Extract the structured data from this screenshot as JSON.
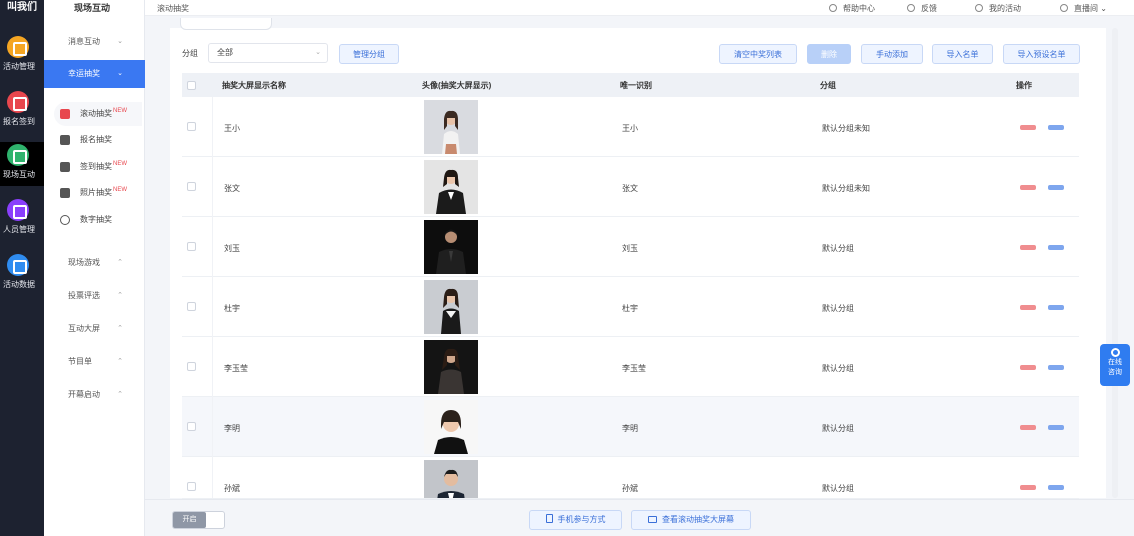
{
  "rail": {
    "logo": "叫我们",
    "items": [
      {
        "label": "活动管理",
        "icon": "calendar-icon",
        "color": "#f5a623"
      },
      {
        "label": "报名签到",
        "icon": "checkin-icon",
        "color": "#e8474e"
      },
      {
        "label": "现场互动",
        "icon": "interaction-icon",
        "color": "#2fb36d"
      },
      {
        "label": "人员管理",
        "icon": "person-icon",
        "color": "#8a3ffc"
      },
      {
        "label": "活动数据",
        "icon": "data-icon",
        "color": "#2f8cf0"
      }
    ]
  },
  "menu": {
    "title": "现场互动",
    "groups_top": [
      {
        "label": "消息互动"
      },
      {
        "label": "幸运抽奖"
      }
    ],
    "sub_items": [
      {
        "label": "滚动抽奖",
        "hot": "NEW",
        "icon": "lottery-icon",
        "color": "#e8474e"
      },
      {
        "label": "报名抽奖",
        "hot": "",
        "icon": "person-lottery-icon",
        "color": "#555555"
      },
      {
        "label": "签到抽奖",
        "hot": "NEW",
        "icon": "checkin-lottery-icon",
        "color": "#555555"
      },
      {
        "label": "照片抽奖",
        "hot": "NEW",
        "icon": "photo-lottery-icon",
        "color": "#555555"
      },
      {
        "label": "数字抽奖",
        "hot": "",
        "icon": "number-lottery-icon",
        "color": "#555555"
      }
    ],
    "groups_bottom": [
      {
        "label": "现场游戏"
      },
      {
        "label": "投票评选"
      },
      {
        "label": "互动大屏"
      },
      {
        "label": "节目单"
      },
      {
        "label": "开幕启动"
      }
    ]
  },
  "topbar": {
    "breadcrumb": "滚动抽奖",
    "links": [
      "帮助中心",
      "反馈",
      "我的活动",
      "直播间"
    ]
  },
  "filter": {
    "label": "分组",
    "select_value": "全部",
    "manage_button": "管理分组"
  },
  "actions": {
    "clear_winners": "清空中奖列表",
    "delete": "删除",
    "add_manual": "手动添加",
    "import_list": "导入名单",
    "import_winner_list": "导入预设名单"
  },
  "table": {
    "columns": [
      "抽奖大屏显示名称",
      "头像(抽奖大屏显示)",
      "唯一识别",
      "分组",
      "操作"
    ],
    "rows": [
      {
        "name": "王小",
        "uid": "王小",
        "group": "默认分组未知"
      },
      {
        "name": "张文",
        "uid": "张文",
        "group": "默认分组未知"
      },
      {
        "name": "刘玉",
        "uid": "刘玉",
        "group": "默认分组"
      },
      {
        "name": "杜宇",
        "uid": "杜宇",
        "group": "默认分组"
      },
      {
        "name": "李玉莹",
        "uid": "李玉莹",
        "group": "默认分组"
      },
      {
        "name": "李明",
        "uid": "李明",
        "group": "默认分组"
      },
      {
        "name": "孙斌",
        "uid": "孙斌",
        "group": "默认分组"
      }
    ]
  },
  "bottombar": {
    "toggle_label": "开启",
    "mobile_button": "手机参与方式",
    "screen_button": "查看滚动抽奖大屏幕"
  },
  "float_help": {
    "line1": "在线",
    "line2": "咨询"
  }
}
